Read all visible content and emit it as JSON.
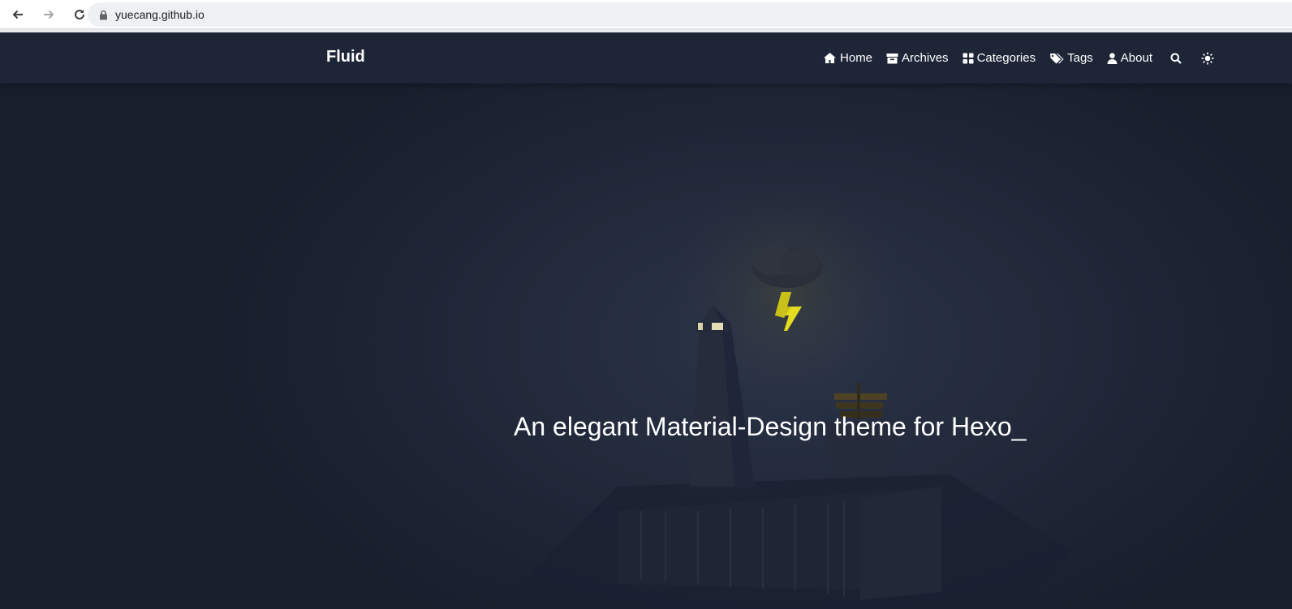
{
  "browser": {
    "url": "yuecang.github.io",
    "back_icon": "arrow-left-icon",
    "forward_icon": "arrow-right-icon",
    "reload_icon": "reload-icon",
    "lock_icon": "lock-icon"
  },
  "navbar": {
    "brand": "Fluid",
    "items": [
      {
        "label": "Home",
        "icon": "home-icon"
      },
      {
        "label": "Archives",
        "icon": "archive-icon"
      },
      {
        "label": "Categories",
        "icon": "grid-icon"
      },
      {
        "label": "Tags",
        "icon": "tags-icon"
      },
      {
        "label": "About",
        "icon": "user-icon"
      }
    ],
    "search_icon": "search-icon",
    "theme_icon": "sun-icon"
  },
  "hero": {
    "subtitle": "An elegant Material-Design theme for Hexo_"
  },
  "colors": {
    "background": "#1c2536",
    "navbar": "#1e2638",
    "text": "#ffffff",
    "lightning": "#e6e020"
  }
}
